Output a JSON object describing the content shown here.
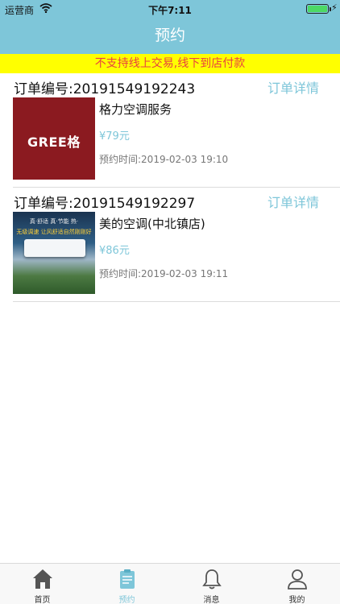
{
  "status_bar": {
    "carrier": "运营商",
    "time": "下午7:11"
  },
  "header": {
    "title": "预约"
  },
  "notice": "不支持线上交易,线下到店付款",
  "orders": [
    {
      "number": "订单编号:20191549192243",
      "detail_label": "订单详情",
      "name": "格力空调服务",
      "price": "¥79元",
      "time": "预约时间:2019-02-03 19:10",
      "thumb_text": "GREE格"
    },
    {
      "number": "订单编号:20191549192297",
      "detail_label": "订单详情",
      "name": "美的空调(中北镇店)",
      "price": "¥86元",
      "time": "预约时间:2019-02-03 19:11",
      "thumb_top_text": "真·舒适  真·节能  热·",
      "thumb_mid_text": "无级调速  让风舒适自然刚刚好"
    }
  ],
  "tabbar": {
    "items": [
      {
        "label": "首页",
        "icon": "home-icon"
      },
      {
        "label": "预约",
        "icon": "booking-icon"
      },
      {
        "label": "消息",
        "icon": "bell-icon"
      },
      {
        "label": "我的",
        "icon": "person-icon"
      }
    ],
    "active_index": 1
  },
  "colors": {
    "accent": "#7ec6d9",
    "notice_bg": "#ffff00",
    "notice_text": "#e8413f"
  }
}
